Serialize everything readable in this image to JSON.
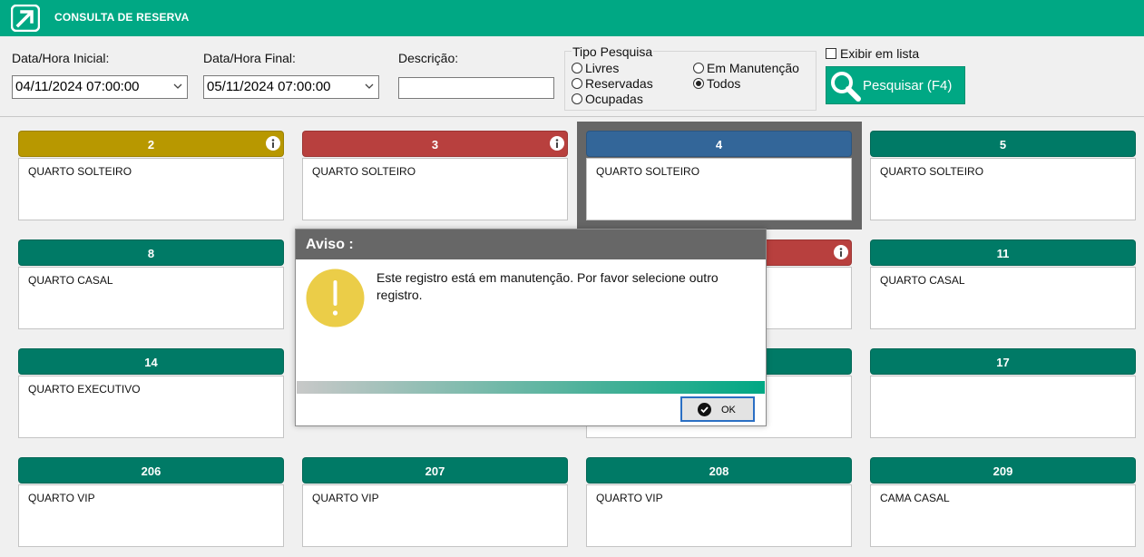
{
  "titlebar": {
    "title": "CONSULTA DE RESERVA",
    "logo_icon": "arrow-up-right-icon"
  },
  "filters": {
    "start_label": "Data/Hora Inicial:",
    "start_value": "04/11/2024 07:00:00",
    "end_label": "Data/Hora Final:",
    "end_value": "05/11/2024 07:00:00",
    "desc_label": "Descrição:",
    "desc_value": "",
    "tipo_label": "Tipo Pesquisa",
    "radios": {
      "livres": "Livres",
      "reservadas": "Reservadas",
      "ocupadas": "Ocupadas",
      "manutencao": "Em Manutenção",
      "todos": "Todos"
    },
    "selected_radio": "Todos",
    "list_check_label": "Exibir em lista",
    "list_checked": false,
    "search_label": "Pesquisar (F4)"
  },
  "colors": {
    "accent": "#00a884",
    "free": "#007a66",
    "reserved": "#b8403e",
    "maintenance": "#b89800",
    "selected": "#336699"
  },
  "cards": [
    {
      "num": "2",
      "type": "QUARTO SOLTEIRO",
      "status": "maintenance",
      "info": true
    },
    {
      "num": "3",
      "type": "QUARTO SOLTEIRO",
      "status": "reserved",
      "info": true
    },
    {
      "num": "4",
      "type": "QUARTO SOLTEIRO",
      "status": "selected",
      "info": false
    },
    {
      "num": "5",
      "type": "QUARTO SOLTEIRO",
      "status": "free",
      "info": false
    },
    {
      "num": "8",
      "type": "QUARTO CASAL",
      "status": "free",
      "info": false
    },
    {
      "num": "",
      "type": "",
      "status": "hidden",
      "info": false
    },
    {
      "num": "",
      "type": "",
      "status": "reserved",
      "info": true
    },
    {
      "num": "11",
      "type": "QUARTO CASAL",
      "status": "free",
      "info": false
    },
    {
      "num": "14",
      "type": "QUARTO EXECUTIVO",
      "status": "free",
      "info": false
    },
    {
      "num": "",
      "type": "",
      "status": "hidden",
      "info": false
    },
    {
      "num": "",
      "type": "",
      "status": "free",
      "info": false
    },
    {
      "num": "17",
      "type": "",
      "status": "free",
      "info": false
    },
    {
      "num": "206",
      "type": "QUARTO VIP",
      "status": "free",
      "info": false
    },
    {
      "num": "207",
      "type": "QUARTO VIP",
      "status": "free",
      "info": false
    },
    {
      "num": "208",
      "type": "QUARTO VIP",
      "status": "free",
      "info": false
    },
    {
      "num": "209",
      "type": "CAMA CASAL",
      "status": "free",
      "info": false
    }
  ],
  "dialog": {
    "title": "Aviso :",
    "icon": "warning-icon",
    "message": "Este registro está em manutenção. Por favor selecione outro registro.",
    "ok_label": "OK"
  }
}
